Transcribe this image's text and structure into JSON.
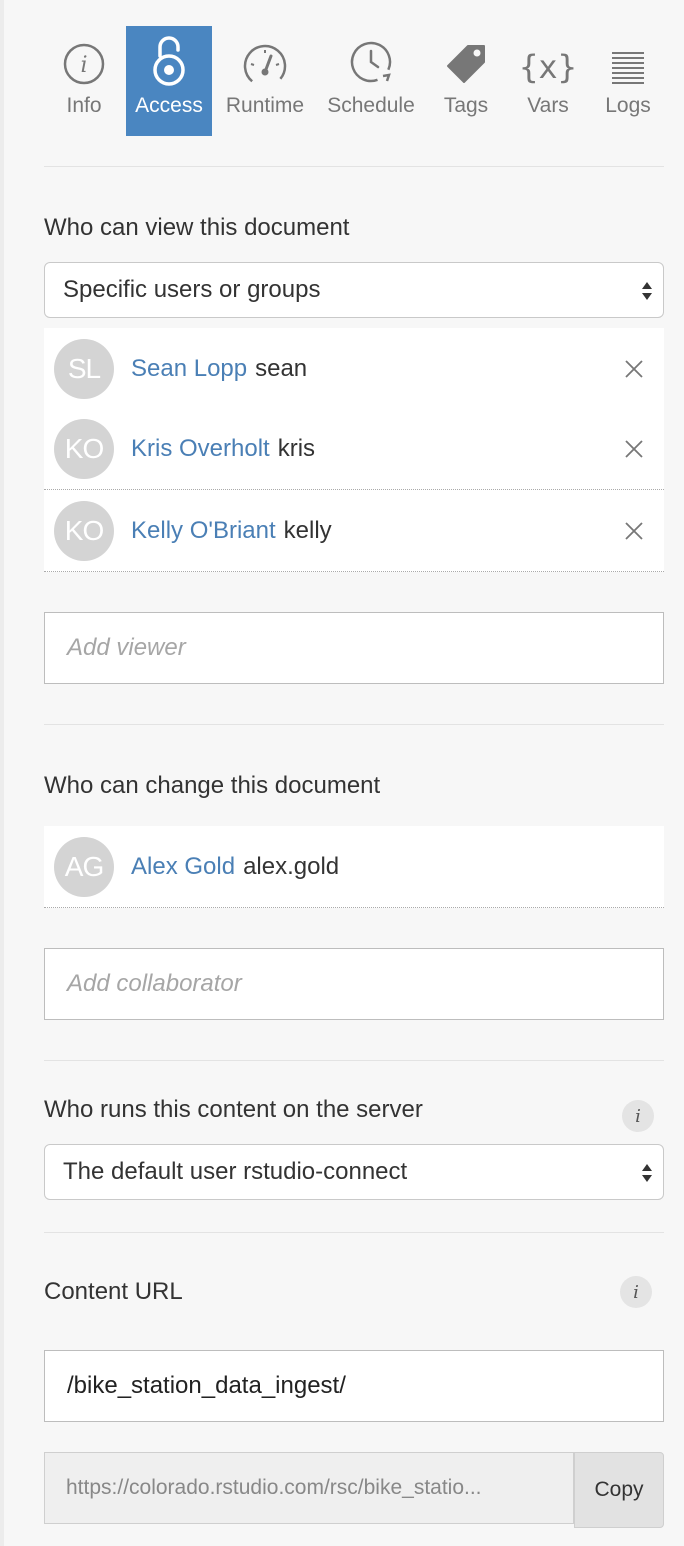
{
  "tabs": [
    {
      "label": "Info",
      "icon": "info-icon"
    },
    {
      "label": "Access",
      "icon": "lock-icon",
      "active": true
    },
    {
      "label": "Runtime",
      "icon": "speedometer-icon"
    },
    {
      "label": "Schedule",
      "icon": "clock-icon"
    },
    {
      "label": "Tags",
      "icon": "tag-icon"
    },
    {
      "label": "Vars",
      "icon": "variable-icon",
      "glyph": "{x}"
    },
    {
      "label": "Logs",
      "icon": "logs-icon"
    }
  ],
  "viewers": {
    "heading": "Who can view this document",
    "select_value": "Specific users or groups",
    "users": [
      {
        "initials": "SL",
        "name": "Sean Lopp",
        "login": "sean"
      },
      {
        "initials": "KO",
        "name": "Kris Overholt",
        "login": "kris"
      },
      {
        "initials": "KO",
        "name": "Kelly O'Briant",
        "login": "kelly"
      }
    ],
    "add_placeholder": "Add viewer"
  },
  "collaborators": {
    "heading": "Who can change this document",
    "users": [
      {
        "initials": "AG",
        "name": "Alex Gold",
        "login": "alex.gold"
      }
    ],
    "add_placeholder": "Add collaborator"
  },
  "runas": {
    "heading": "Who runs this content on the server",
    "select_value": "The default user rstudio-connect",
    "info_glyph": "i"
  },
  "content_url": {
    "heading": "Content URL",
    "info_glyph": "i",
    "path_value": "/bike_station_data_ingest/",
    "full_url": "https://colorado.rstudio.com/rsc/bike_statio...",
    "copy_label": "Copy"
  },
  "colors": {
    "accent": "#4a86c1",
    "link": "#4a7fb5",
    "avatar": "#d4d4d4"
  }
}
